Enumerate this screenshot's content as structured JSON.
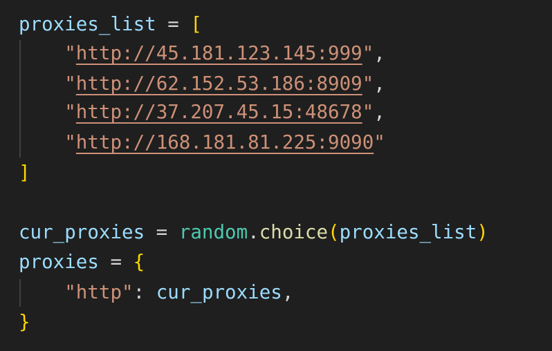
{
  "code": {
    "line1": {
      "var": "proxies_list",
      "op": " = ",
      "open": "["
    },
    "urls": [
      "http://45.181.123.145:999",
      "http://62.152.53.186:8909",
      "http://37.207.45.15:48678",
      "http://168.181.81.225:9090"
    ],
    "close_list": "]",
    "line_choice": {
      "var": "cur_proxies",
      "op": " = ",
      "module": "random",
      "dot": ".",
      "fn": "choice",
      "open": "(",
      "arg": "proxies_list",
      "close": ")"
    },
    "line_dict": {
      "var": "proxies",
      "op": " = ",
      "open": "{"
    },
    "dict_entry": {
      "quote": "\"",
      "key": "http",
      "colon": ": ",
      "value": "cur_proxies",
      "comma": ","
    },
    "close_dict": "}"
  },
  "theme": {
    "background": "#1f1f1f",
    "variable": "#9cdcfe",
    "string": "#ce9178",
    "bracket": "#ffd700",
    "class": "#4ec9b0",
    "function": "#dcdcaa"
  }
}
